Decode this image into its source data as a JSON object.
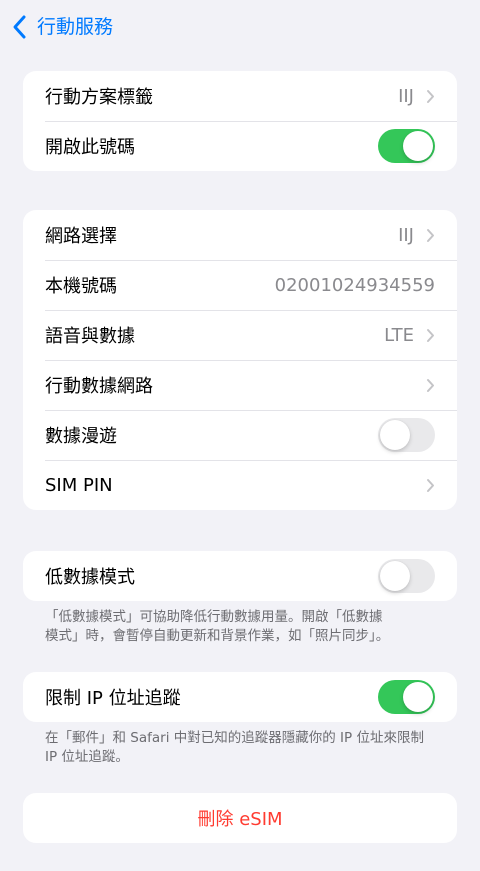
{
  "nav": {
    "back_label": "行動服務"
  },
  "group1": {
    "plan_label": {
      "label": "行動方案標籤",
      "value": "IIJ"
    },
    "turn_on_line": {
      "label": "開啟此號碼",
      "toggle": "on"
    }
  },
  "group2": {
    "network_selection": {
      "label": "網路選擇",
      "value": "IIJ"
    },
    "my_number": {
      "label": "本機號碼",
      "value": "02001024934559"
    },
    "voice_data": {
      "label": "語音與數據",
      "value": "LTE"
    },
    "data_network": {
      "label": "行動數據網路"
    },
    "data_roaming": {
      "label": "數據漫遊",
      "toggle": "off"
    },
    "sim_pin": {
      "label": "SIM PIN"
    }
  },
  "group3": {
    "low_data_mode": {
      "label": "低數據模式",
      "toggle": "off"
    },
    "footnote_line1": "「低數據模式」可協助降低行動數據用量。開啟「低數據",
    "footnote_line2": "模式」時，會暫停自動更新和背景作業，如「照片同步」。"
  },
  "group4": {
    "limit_ip_tracking": {
      "label": "限制 IP 位址追蹤",
      "toggle": "on"
    },
    "footnote_line1": "在「郵件」和 Safari 中對已知的追蹤器隱藏你的 IP 位址來限制",
    "footnote_line2": "IP 位址追蹤。"
  },
  "group5": {
    "delete_label": "刪除 eSIM"
  },
  "colors": {
    "accent": "#007aff",
    "toggle_on": "#34c759",
    "destructive": "#ff3b30",
    "background": "#f2f2f7"
  },
  "icons": {
    "back": "chevron-left-icon",
    "disclosure": "chevron-right-icon"
  }
}
